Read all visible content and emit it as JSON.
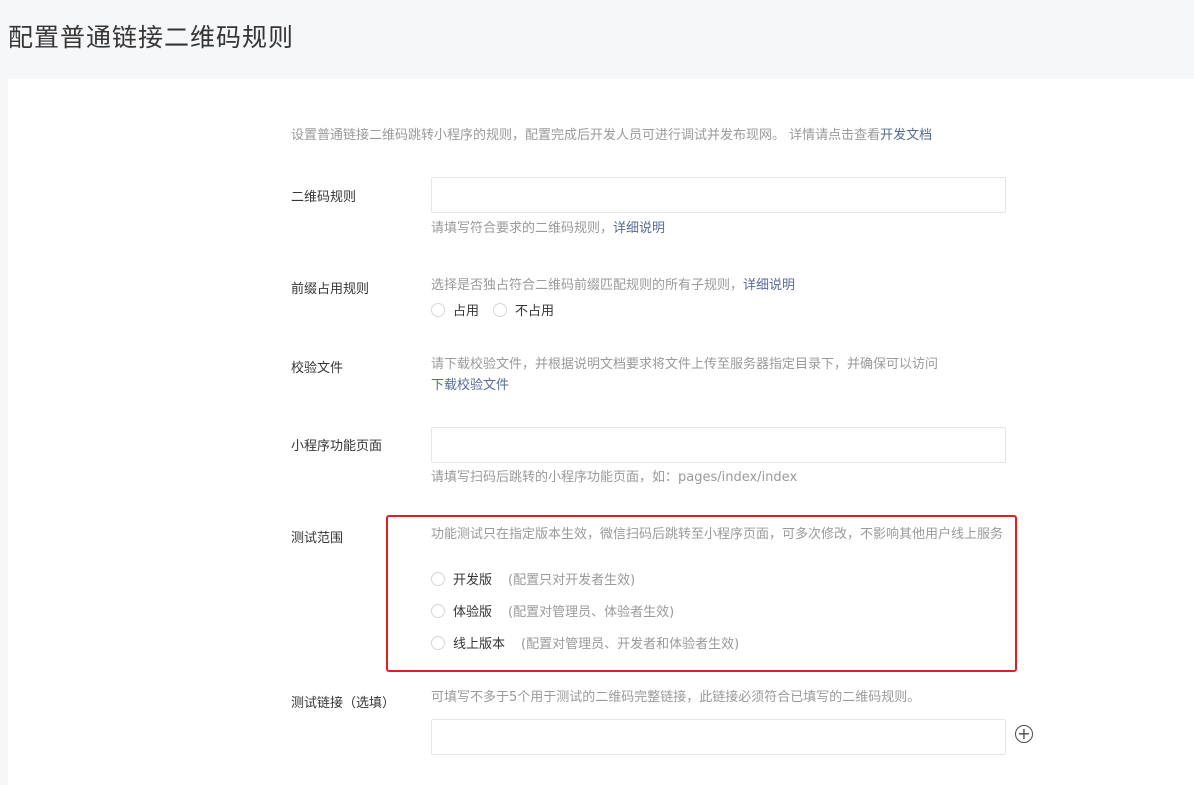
{
  "page": {
    "title": "配置普通链接二维码规则"
  },
  "intro": {
    "text": "设置普通链接二维码跳转小程序的规则，配置完成后开发人员可进行调试并发布现网。 详情请点击查看",
    "link": "开发文档"
  },
  "qr_rule": {
    "label": "二维码规则",
    "value": "",
    "hint": "请填写符合要求的二维码规则，",
    "hint_link": "详细说明"
  },
  "prefix": {
    "label": "前缀占用规则",
    "hint": "选择是否独占符合二维码前缀匹配规则的所有子规则，",
    "hint_link": "详细说明",
    "options": [
      "占用",
      "不占用"
    ]
  },
  "verify_file": {
    "label": "校验文件",
    "hint": "请下载校验文件，并根据说明文档要求将文件上传至服务器指定目录下，并确保可以访问",
    "download_link": "下载校验文件"
  },
  "miniprogram_page": {
    "label": "小程序功能页面",
    "value": "",
    "hint": "请填写扫码后跳转的小程序功能页面，如：pages/index/index"
  },
  "test_scope": {
    "label": "测试范围",
    "hint": "功能测试只在指定版本生效，微信扫码后跳转至小程序页面，可多次修改，不影响其他用户线上服务",
    "options": [
      {
        "name": "开发版",
        "desc": "(配置只对开发者生效)"
      },
      {
        "name": "体验版",
        "desc": "(配置对管理员、体验者生效)"
      },
      {
        "name": "线上版本",
        "desc": "(配置对管理员、开发者和体验者生效)"
      }
    ]
  },
  "test_links": {
    "label": "测试链接（选填）",
    "hint": "可填写不多于5个用于测试的二维码完整链接，此链接必须符合已填写的二维码规则。",
    "value": "",
    "add_icon": "plus-circle-icon"
  },
  "colors": {
    "link": "#576b95",
    "highlight": "#e02020",
    "muted": "#9a9a9a"
  }
}
